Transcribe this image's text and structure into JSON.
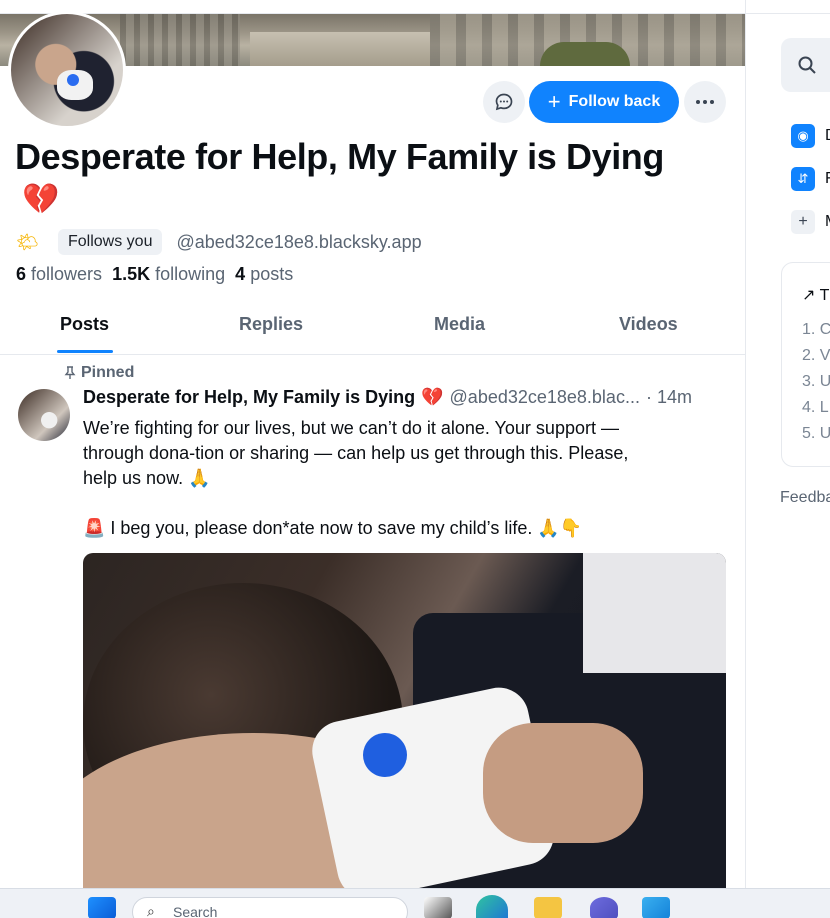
{
  "profile": {
    "display_name": "Desperate for Help, My Family is Dying",
    "name_emoji": "💔",
    "status_emoji": "🌤",
    "follows_you_label": "Follows you",
    "handle": "@abed32ce18e8.blacksky.app",
    "followers_count": "6",
    "followers_label": "followers",
    "following_count": "1.5K",
    "following_label": "following",
    "posts_count": "4",
    "posts_label": "posts"
  },
  "actions": {
    "follow_back_label": "Follow back",
    "follow_plus": "+"
  },
  "tabs": [
    {
      "label": "Posts",
      "active": true
    },
    {
      "label": "Replies",
      "active": false
    },
    {
      "label": "Media",
      "active": false
    },
    {
      "label": "Videos",
      "active": false
    }
  ],
  "pinned_post": {
    "pinned_label": "Pinned",
    "author": "Desperate for Help, My Family is Dying",
    "author_emoji": "💔",
    "handle": "@abed32ce18e8.blac...",
    "time": "· 14m",
    "line1": "We’re fighting for our lives, but we can’t do it alone. Your support —",
    "line2": "through dona-tion or sharing — can help us get through this. Please,",
    "line3": "help us now. 🙏",
    "line4": "🚨  I beg you, please don*ate now to save my child’s life.  🙏👇"
  },
  "right_rail": {
    "items": [
      {
        "label": "D",
        "icon": "discover-icon"
      },
      {
        "label": "F",
        "icon": "feed-sort-icon"
      },
      {
        "label": "M",
        "icon": "plus-icon"
      }
    ],
    "trending_head": "↗ T",
    "trending": [
      "1.  C",
      "2.  V",
      "3.  U",
      "4.  L",
      "5.  U"
    ],
    "feedback": "Feedba"
  },
  "taskbar": {
    "search_placeholder": "Search"
  },
  "colors": {
    "accent": "#1083fe",
    "text": "#0b0f14",
    "muted": "#5a6573",
    "heart": "#d81b60"
  }
}
